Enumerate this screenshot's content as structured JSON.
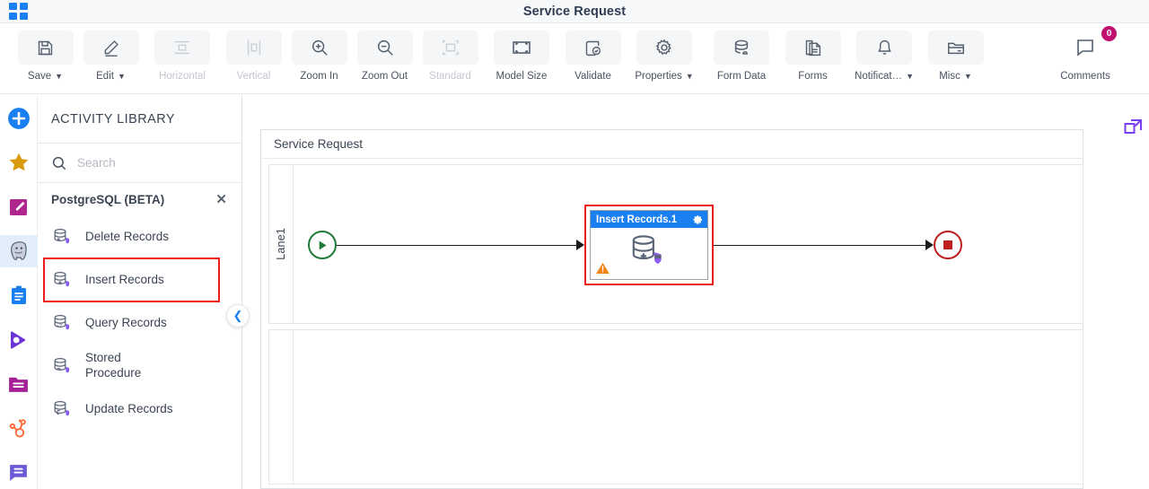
{
  "window": {
    "title": "Service Request",
    "app_grid_icon": "app-grid-icon"
  },
  "toolbar": {
    "items": [
      {
        "label": "Save",
        "icon": "save-icon",
        "caret": true,
        "disabled": false
      },
      {
        "label": "Edit",
        "icon": "pencil-icon",
        "caret": true,
        "disabled": false
      },
      {
        "label": "Horizontal",
        "icon": "horizontal-align-icon",
        "caret": false,
        "disabled": true
      },
      {
        "label": "Vertical",
        "icon": "vertical-align-icon",
        "caret": false,
        "disabled": true
      },
      {
        "label": "Zoom In",
        "icon": "zoom-in-icon",
        "caret": false,
        "disabled": false
      },
      {
        "label": "Zoom Out",
        "icon": "zoom-out-icon",
        "caret": false,
        "disabled": false
      },
      {
        "label": "Standard",
        "icon": "standard-size-icon",
        "caret": false,
        "disabled": true
      },
      {
        "label": "Model Size",
        "icon": "model-size-icon",
        "caret": false,
        "disabled": false
      },
      {
        "label": "Validate",
        "icon": "validate-icon",
        "caret": false,
        "disabled": false
      },
      {
        "label": "Properties",
        "icon": "gear-icon",
        "caret": true,
        "disabled": false
      },
      {
        "label": "Form Data",
        "icon": "form-data-icon",
        "caret": false,
        "disabled": false
      },
      {
        "label": "Forms",
        "icon": "forms-icon",
        "caret": false,
        "disabled": false
      },
      {
        "label": "Notificat…",
        "icon": "bell-icon",
        "caret": true,
        "disabled": false
      },
      {
        "label": "Misc",
        "icon": "misc-folder-icon",
        "caret": true,
        "disabled": false
      }
    ],
    "comments": {
      "label": "Comments",
      "icon": "comment-icon",
      "badge": "0",
      "badge_color": "#c0116e"
    }
  },
  "rail": {
    "items": [
      {
        "name": "add-icon",
        "color": "#1a7ff0",
        "active": false
      },
      {
        "name": "favorites-star-icon",
        "color": "#d99a0d",
        "active": false
      },
      {
        "name": "edit-square-icon",
        "color": "#b0268f",
        "active": false
      },
      {
        "name": "postgresql-elephant-icon",
        "color": "#6c7a96",
        "active": true
      },
      {
        "name": "clipboard-icon",
        "color": "#1a7ff0",
        "active": false
      },
      {
        "name": "activecampaign-icon",
        "color": "#6a34d6",
        "active": false
      },
      {
        "name": "folder-icon",
        "color": "#a52096",
        "active": false
      },
      {
        "name": "hubspot-icon",
        "color": "#ff6a32",
        "active": false
      },
      {
        "name": "message-icon",
        "color": "#6a5ad6",
        "active": false
      }
    ]
  },
  "panel": {
    "header": "ACTIVITY LIBRARY",
    "search": {
      "value": "",
      "placeholder": "Search",
      "icon": "search-icon"
    },
    "group": {
      "title": "PostgreSQL (BETA)",
      "close_icon": "close-icon"
    },
    "activities": [
      {
        "label": "Delete Records",
        "icon": "db-delete-icon",
        "highlighted": false
      },
      {
        "label": "Insert Records",
        "icon": "db-insert-icon",
        "highlighted": true
      },
      {
        "label": "Query Records",
        "icon": "db-query-icon",
        "highlighted": false
      },
      {
        "label": "Stored Procedure",
        "icon": "db-stored-procedure-icon",
        "highlighted": false
      },
      {
        "label": "Update Records",
        "icon": "db-update-icon",
        "highlighted": false
      }
    ],
    "collapse_icon": "chevron-left-icon"
  },
  "canvas": {
    "diagram_title": "Service Request",
    "lane_label": "Lane1",
    "expand_icon": "expand-icon",
    "expand_color": "#7b3ff2",
    "nodes": [
      {
        "type": "start",
        "name": "start-event",
        "icon": "play-icon",
        "color": "#1f7a38"
      },
      {
        "type": "task",
        "name": "insert-records-task",
        "title": "Insert Records.1",
        "icon": "db-insert-icon",
        "gear_icon": "gear-icon",
        "warning_icon": "warning-icon",
        "selected": true,
        "header_color": "#1a7ff0",
        "selection_color": "#ee1b1b"
      },
      {
        "type": "end",
        "name": "end-event",
        "icon": "stop-icon",
        "color": "#c01f1f"
      }
    ]
  }
}
